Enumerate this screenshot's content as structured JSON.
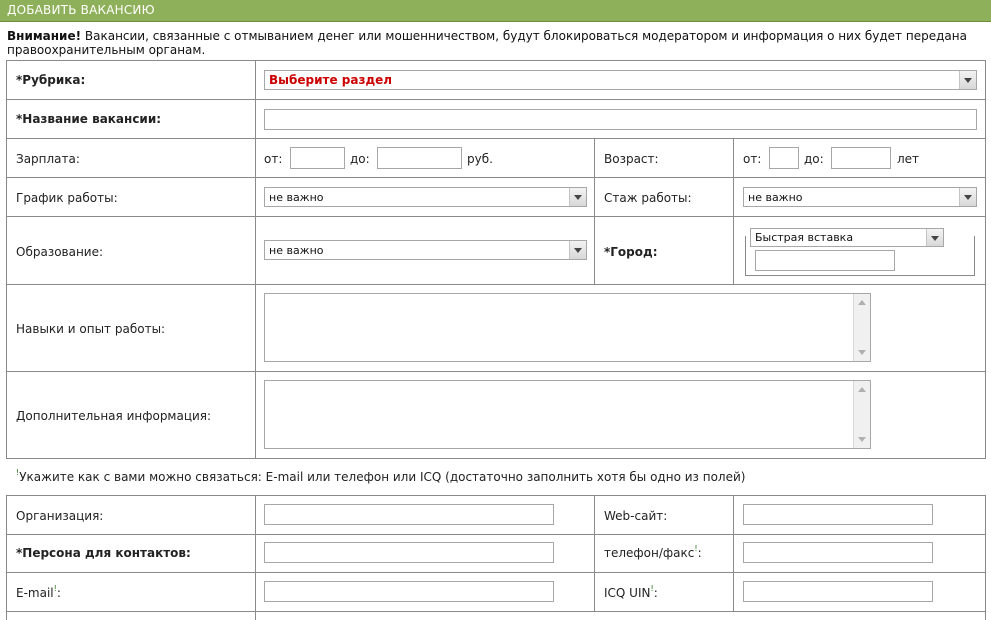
{
  "header": {
    "title": "ДОБАВИТЬ ВАКАНСИЮ"
  },
  "warning": {
    "bold": "Внимание!",
    "text": " Вакансии, связанные с отмыванием денег или мошенничеством, будут блокироваться модератором и информация о них будет передана правоохранительным органам."
  },
  "rubric": {
    "label": "*Рубрика:",
    "selected": "Выберите раздел"
  },
  "title": {
    "label": "*Название вакансии:",
    "value": ""
  },
  "salary": {
    "label": "Зарплата:",
    "from": "от:",
    "to": "до:",
    "unit": "руб.",
    "from_value": "",
    "to_value": ""
  },
  "age": {
    "label": "Возраст:",
    "from": "от:",
    "to": "до:",
    "unit": "лет"
  },
  "schedule": {
    "label": "График работы:",
    "selected": "не важно"
  },
  "experience": {
    "label": "Стаж работы:",
    "selected": "не важно"
  },
  "education": {
    "label": "Образование:",
    "selected": "не важно"
  },
  "city": {
    "label": "*Город:",
    "quick_insert": "Быстрая вставка",
    "value": ""
  },
  "skills": {
    "label": "Навыки и опыт работы:",
    "value": ""
  },
  "additional": {
    "label": "Дополнительная информация:",
    "value": ""
  },
  "contact_note": {
    "mark": "!",
    "text": "Укажите как с вами можно связаться: E-mail или телефон или ICQ (достаточно заполнить хотя бы одно из полей)"
  },
  "organization": {
    "label": "Организация:",
    "value": ""
  },
  "website": {
    "label": "Web-сайт:",
    "value": ""
  },
  "person": {
    "label": "*Персона для контактов:",
    "value": ""
  },
  "phone": {
    "label": "телефон/факс",
    "mark": "!",
    "colon": ":",
    "value": ""
  },
  "email": {
    "label": "E-mail",
    "mark": "!",
    "colon": ":",
    "value": ""
  },
  "icq": {
    "label": "ICQ UIN",
    "mark": "!",
    "colon": ":",
    "value": ""
  },
  "colors": {
    "header": "#8fb05a",
    "green_text": "#2e7d1f",
    "rubric_red": "#cc0000"
  }
}
